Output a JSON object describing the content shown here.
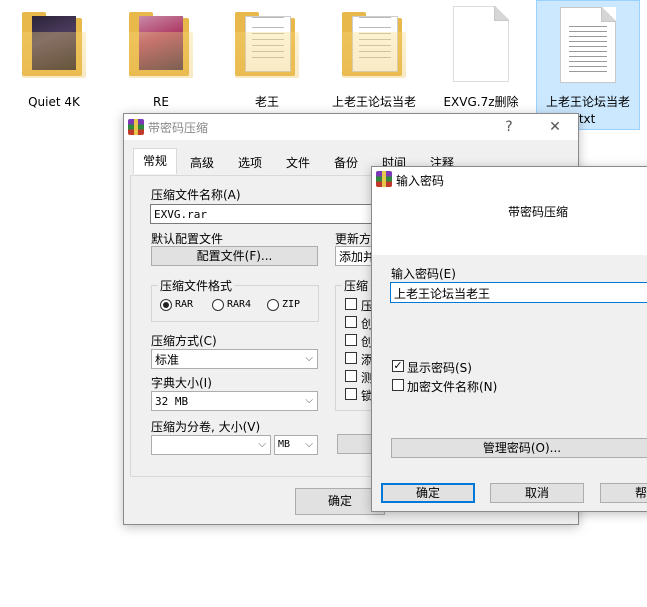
{
  "desktop": {
    "icons": [
      {
        "label": "Quiet 4K",
        "kind": "folder"
      },
      {
        "label": "RE",
        "kind": "folder"
      },
      {
        "label": "老王",
        "kind": "folder"
      },
      {
        "label": "上老王论坛当老",
        "kind": "folder"
      },
      {
        "label": "EXVG.7z删除",
        "kind": "file"
      },
      {
        "label": "上老王论坛当老",
        "label2": "王.txt",
        "kind": "txt",
        "selected": true
      }
    ]
  },
  "winrar_dialog": {
    "title": "带密码压缩",
    "help_btn": "?",
    "close_btn": "✕",
    "tabs": [
      "常规",
      "高级",
      "选项",
      "文件",
      "备份",
      "时间",
      "注释"
    ],
    "archive_name_label": "压缩文件名称(A)",
    "archive_name_value": "EXVG.rar",
    "profile_label": "默认配置文件",
    "profile_button": "配置文件(F)...",
    "update_label": "更新方",
    "update_value": "添加并",
    "format_group": "压缩文件格式",
    "formats": [
      "RAR",
      "RAR4",
      "ZIP"
    ],
    "method_label": "压缩方式(C)",
    "method_value": "标准",
    "dict_label": "字典大小(I)",
    "dict_value": "32 MB",
    "split_label": "压缩为分卷, 大小(V)",
    "split_unit": "MB",
    "options_group": "压缩",
    "options": [
      "压",
      "创",
      "创",
      "添",
      "测",
      "锁"
    ],
    "ok_button": "确定"
  },
  "password_dialog": {
    "title": "输入密码",
    "heading": "带密码压缩",
    "password_label": "输入密码(E)",
    "password_value": "上老王论坛当老王",
    "show_password": "显示密码(S)",
    "encrypt_names": "加密文件名称(N)",
    "manage_button": "管理密码(O)...",
    "ok_button": "确定",
    "cancel_button": "取消",
    "help_button": "帮"
  }
}
